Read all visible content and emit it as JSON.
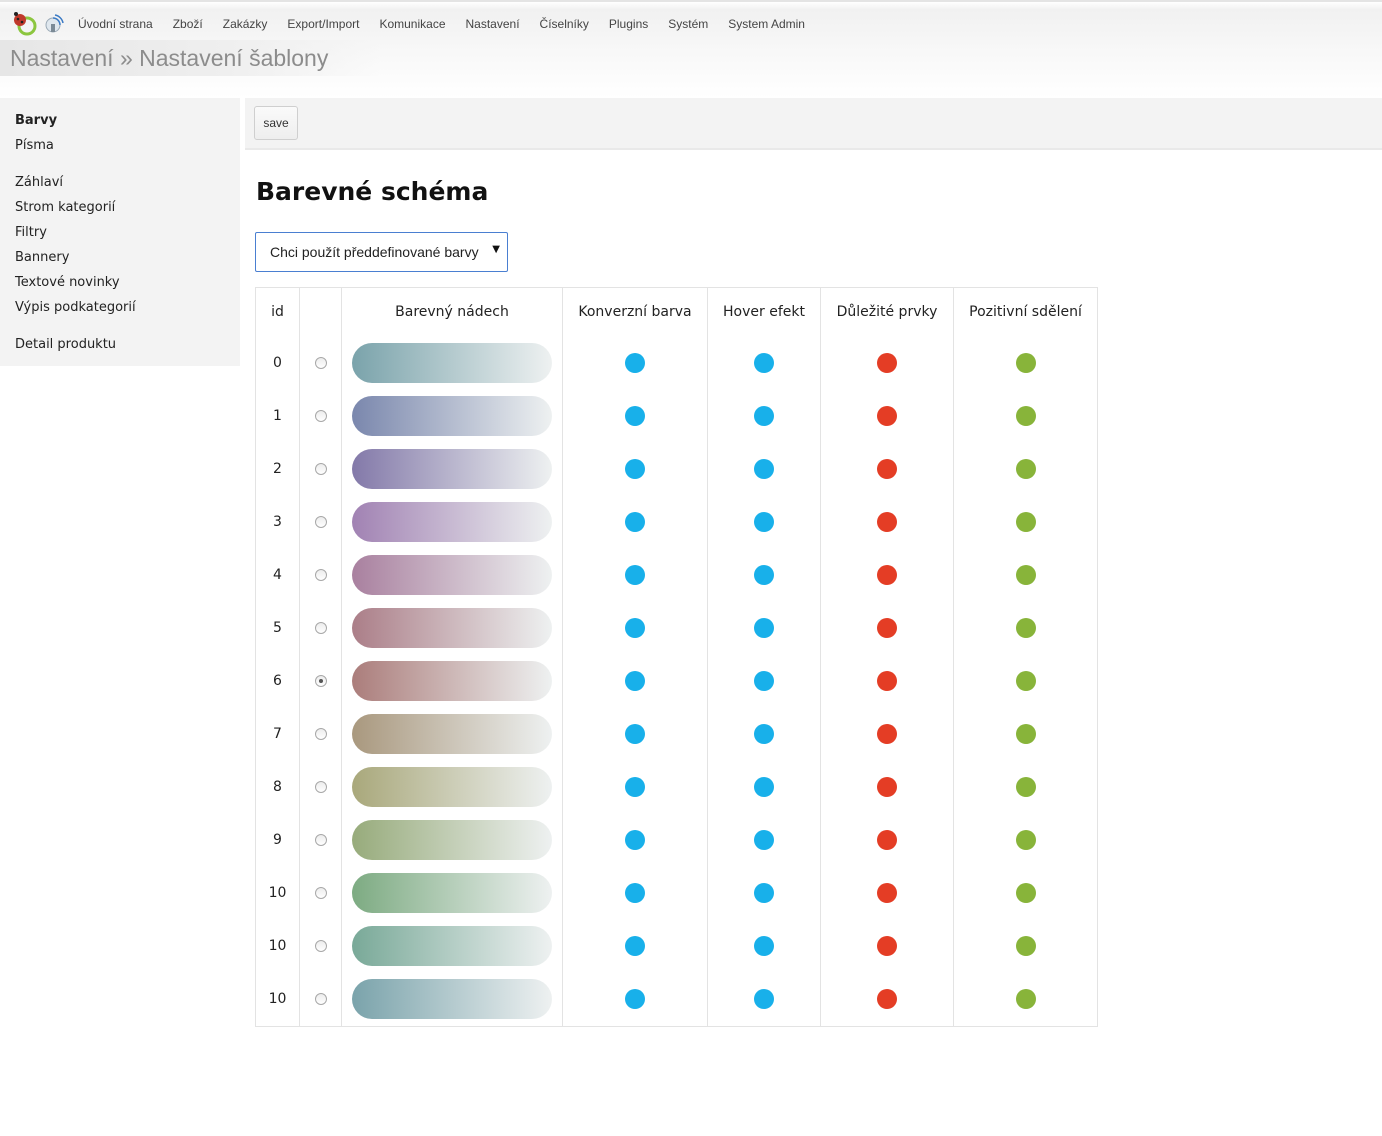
{
  "nav": {
    "items": [
      "Úvodní strana",
      "Zboží",
      "Zakázky",
      "Export/Import",
      "Komunikace",
      "Nastavení",
      "Číselníky",
      "Plugins",
      "Systém",
      "System Admin"
    ]
  },
  "breadcrumb": "Nastavení » Nastavení šablony",
  "sidebar": {
    "items": [
      "Barvy",
      "Písma",
      "Záhlaví",
      "Strom kategorií",
      "Filtry",
      "Bannery",
      "Textové novinky",
      "Výpis podkategorií",
      "Detail produktu"
    ],
    "active": "Barvy"
  },
  "toolbar": {
    "save_label": "save"
  },
  "main": {
    "heading": "Barevné schéma",
    "select_value": "Chci použít předdefinované barvy"
  },
  "table": {
    "headers": [
      "id",
      "",
      "Barevný nádech",
      "Konverzní barva",
      "Hover efekt",
      "Důležité prvky",
      "Pozitivní sdělení"
    ],
    "colors": {
      "conversion": "#18b0ea",
      "hover": "#18b0ea",
      "important": "#e43d25",
      "positive": "#88b43a"
    },
    "rows": [
      {
        "id": "0",
        "selected": false,
        "tint": "#7aa3ab"
      },
      {
        "id": "1",
        "selected": false,
        "tint": "#7a87ad"
      },
      {
        "id": "2",
        "selected": false,
        "tint": "#8379a9"
      },
      {
        "id": "3",
        "selected": false,
        "tint": "#a182b3"
      },
      {
        "id": "4",
        "selected": false,
        "tint": "#a9809f"
      },
      {
        "id": "5",
        "selected": false,
        "tint": "#ab7e88"
      },
      {
        "id": "6",
        "selected": true,
        "tint": "#ab7d7b"
      },
      {
        "id": "7",
        "selected": false,
        "tint": "#a9987e"
      },
      {
        "id": "8",
        "selected": false,
        "tint": "#a9a87b"
      },
      {
        "id": "9",
        "selected": false,
        "tint": "#97ab7b"
      },
      {
        "id": "10",
        "selected": false,
        "tint": "#7dab82"
      },
      {
        "id": "10",
        "selected": false,
        "tint": "#79a998"
      },
      {
        "id": "10",
        "selected": false,
        "tint": "#7aa3ab"
      }
    ]
  }
}
